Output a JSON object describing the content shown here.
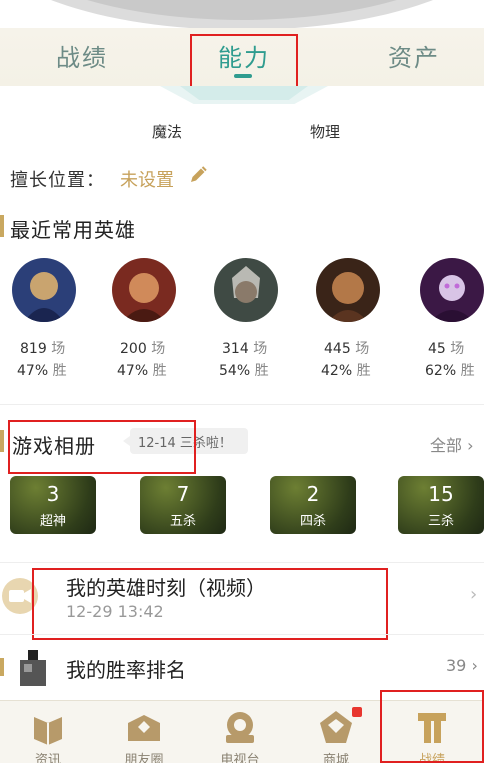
{
  "tabs": [
    {
      "label": "战绩",
      "active": false
    },
    {
      "label": "能力",
      "active": true
    },
    {
      "label": "资产",
      "active": false
    }
  ],
  "radar": {
    "labels": [
      "魔法",
      "物理"
    ]
  },
  "position": {
    "label": "擅长位置：",
    "value": "未设置",
    "edit_icon": "pencil-icon"
  },
  "recent_heroes": {
    "title": "最近常用英雄",
    "heroes": [
      {
        "games": "819",
        "games_unit": "场",
        "win_rate": "47%",
        "win_unit": "胜",
        "colors": [
          "#2b3f78",
          "#c9a46f"
        ]
      },
      {
        "games": "200",
        "games_unit": "场",
        "win_rate": "47%",
        "win_unit": "胜",
        "colors": [
          "#7a2a20",
          "#d08a5a"
        ]
      },
      {
        "games": "314",
        "games_unit": "场",
        "win_rate": "54%",
        "win_unit": "胜",
        "colors": [
          "#3f4a44",
          "#b9b9b3"
        ]
      },
      {
        "games": "445",
        "games_unit": "场",
        "win_rate": "42%",
        "win_unit": "胜",
        "colors": [
          "#3a2418",
          "#b37848"
        ]
      },
      {
        "games": "45",
        "games_unit": "场",
        "win_rate": "62%",
        "win_unit": "胜",
        "colors": [
          "#3b1845",
          "#c06bd8"
        ]
      }
    ]
  },
  "album": {
    "title": "游戏相册",
    "tag": "12-14 三杀啦！",
    "all_label": "全部",
    "cards": [
      {
        "count": "3",
        "label": "超神"
      },
      {
        "count": "7",
        "label": "五杀"
      },
      {
        "count": "2",
        "label": "四杀"
      },
      {
        "count": "15",
        "label": "三杀"
      }
    ]
  },
  "moments": {
    "title": "我的英雄时刻（视频）",
    "timestamp": "12-29 13:42"
  },
  "ranking": {
    "title": "我的胜率排名",
    "value": "39"
  },
  "bottom_nav": [
    {
      "label": "资讯",
      "icon": "news-icon",
      "active": false,
      "badge": false
    },
    {
      "label": "朋友圈",
      "icon": "friends-icon",
      "active": false,
      "badge": false
    },
    {
      "label": "电视台",
      "icon": "tv-icon",
      "active": false,
      "badge": false
    },
    {
      "label": "商城",
      "icon": "shop-icon",
      "active": false,
      "badge": true
    },
    {
      "label": "战绩",
      "icon": "record-icon",
      "active": true,
      "badge": false
    }
  ],
  "colors": {
    "accent": "#2f9c8f",
    "gold": "#c7a25c",
    "annotation": "#e02020"
  }
}
